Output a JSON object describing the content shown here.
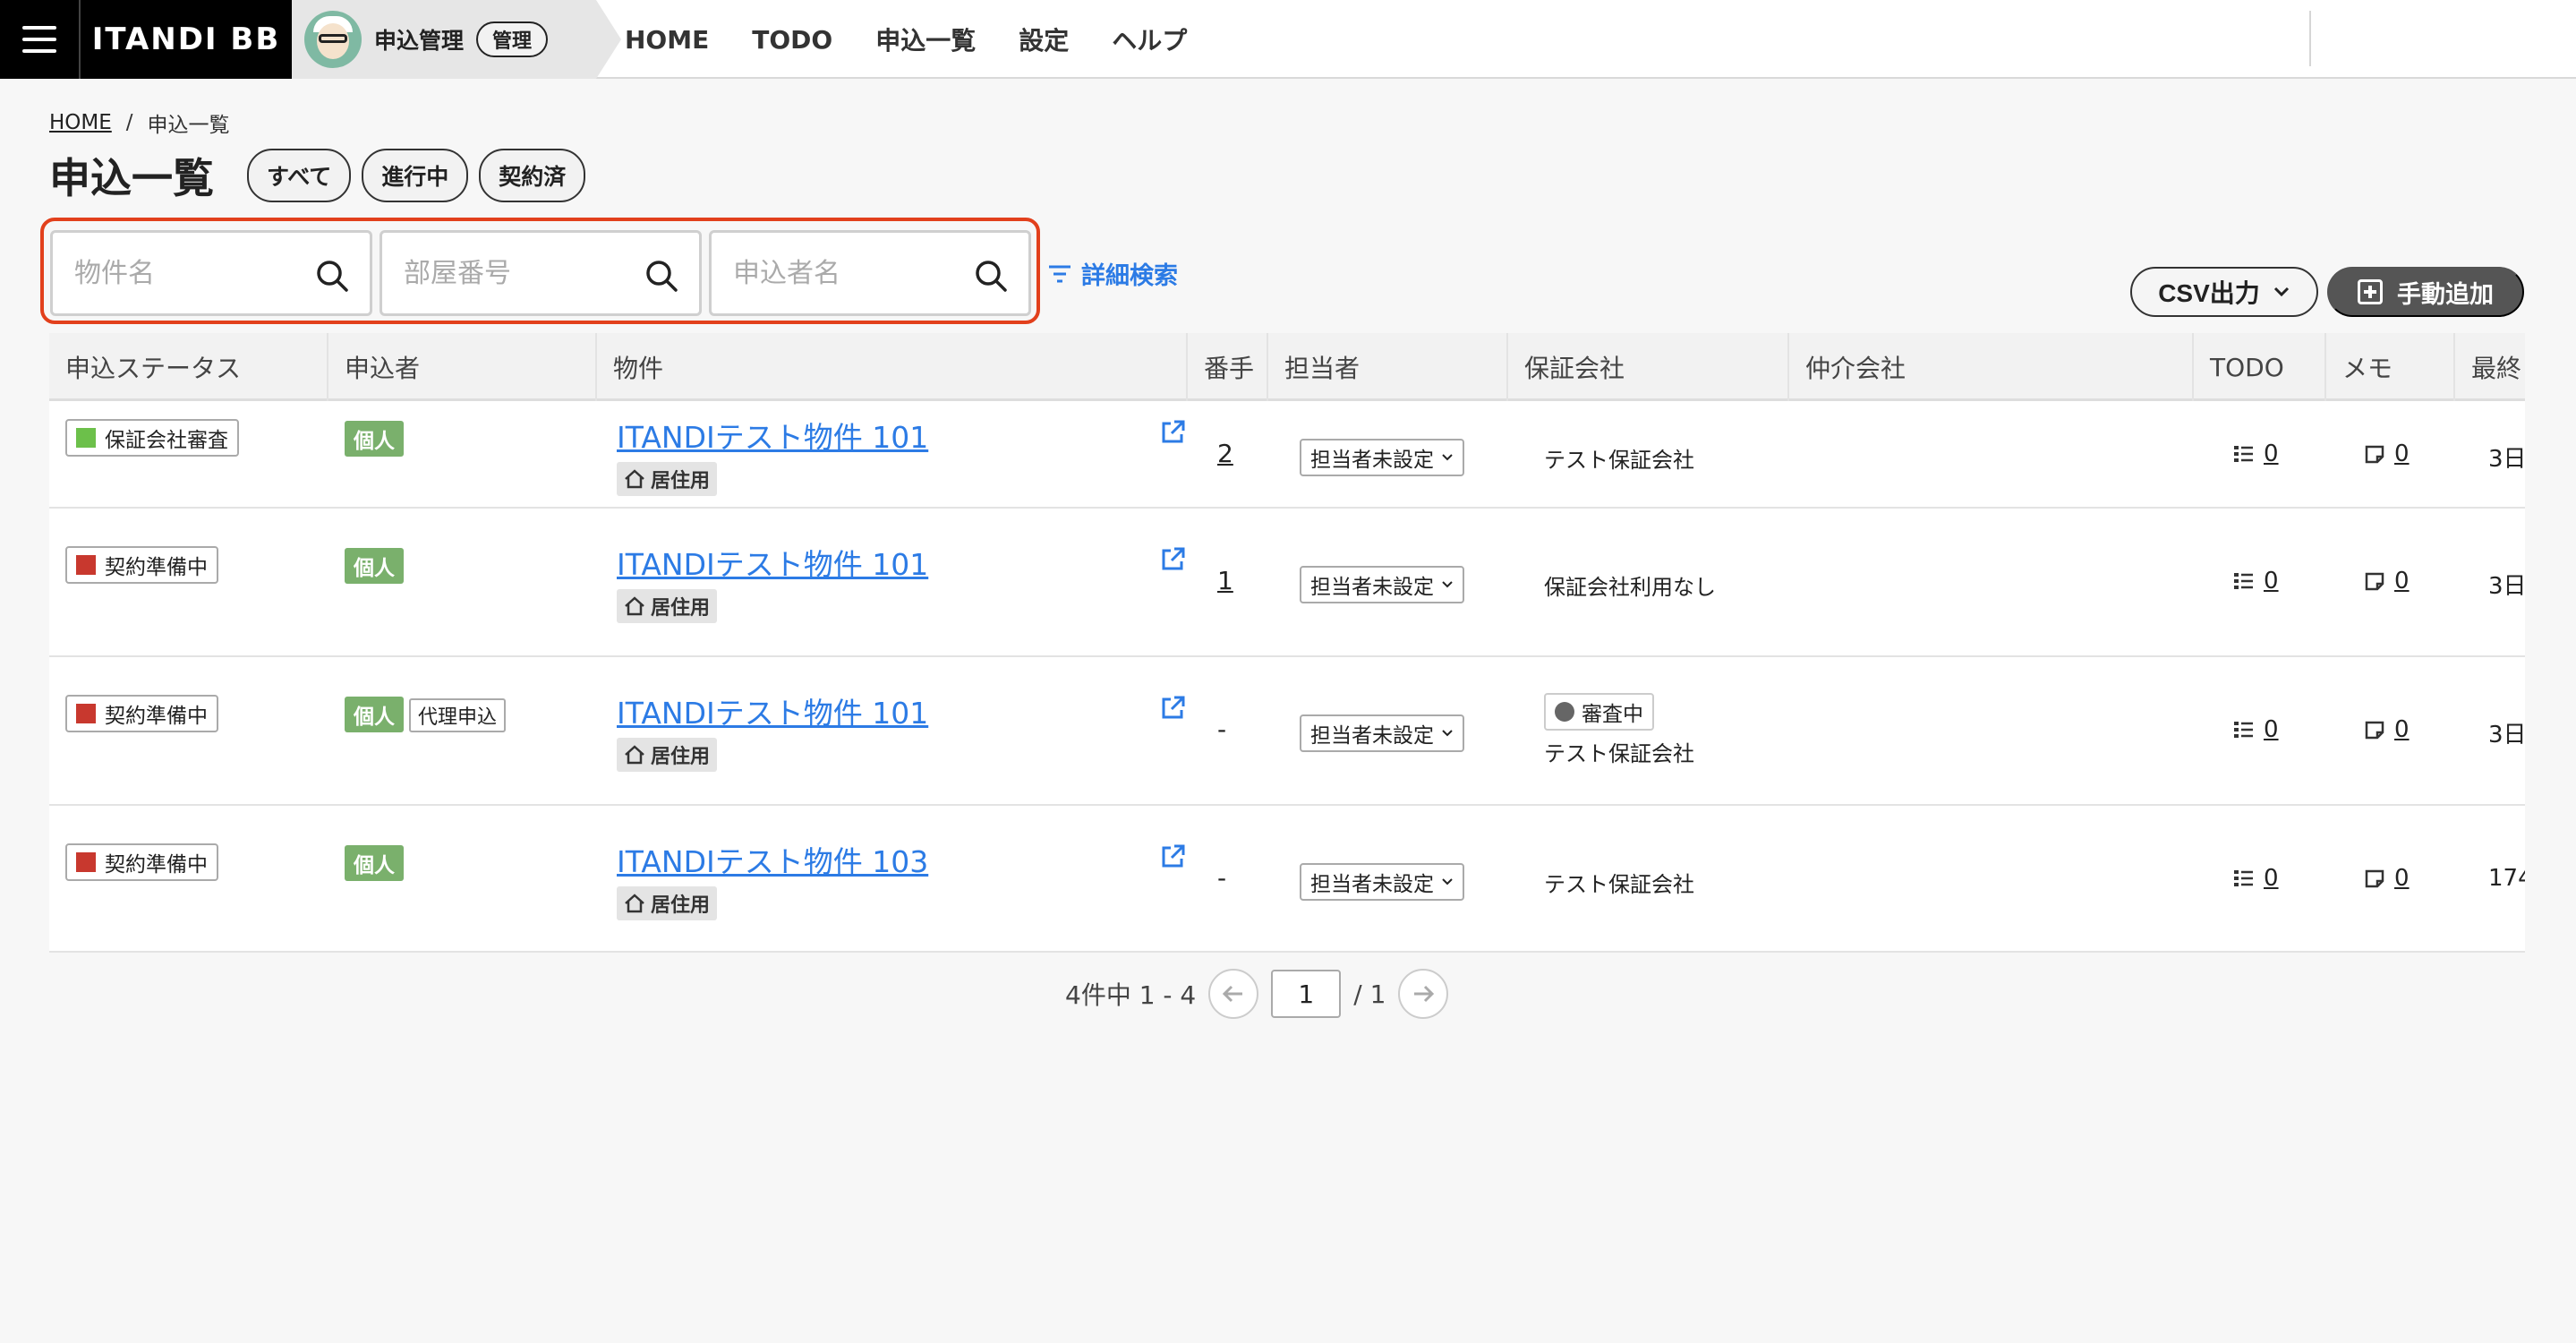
{
  "header": {
    "brand": "ITANDI BB",
    "app_title": "申込管理",
    "admin_badge": "管理",
    "nav": [
      "HOME",
      "TODO",
      "申込一覧",
      "設定",
      "ヘルプ"
    ]
  },
  "breadcrumb": {
    "home": "HOME",
    "separator": "/",
    "current": "申込一覧"
  },
  "page": {
    "title": "申込一覧",
    "filter_tabs": [
      "すべて",
      "進行中",
      "契約済"
    ]
  },
  "search": {
    "property_placeholder": "物件名",
    "room_placeholder": "部屋番号",
    "applicant_placeholder": "申込者名",
    "advanced_label": "詳細検索",
    "highlight_color": "#e2401c"
  },
  "actions": {
    "csv_label": "CSV出力",
    "add_label": "手動追加"
  },
  "table": {
    "columns": [
      "申込ステータス",
      "申込者",
      "物件",
      "番手",
      "担当者",
      "保証会社",
      "仲介会社",
      "TODO",
      "メモ",
      "最終"
    ],
    "rows": [
      {
        "status": "保証会社審査",
        "status_color": "#6cc04a",
        "applicant": "個人",
        "proxy": "",
        "property": "ITANDIテスト物件 101",
        "usage": "居住用",
        "number": "2",
        "assignee": "担当者未設定",
        "guarantor_badge": "",
        "guarantor": "テスト保証会社",
        "todo": "0",
        "memo": "0",
        "date": "3日"
      },
      {
        "status": "契約準備中",
        "status_color": "#c8382e",
        "applicant": "個人",
        "proxy": "",
        "property": "ITANDIテスト物件 101",
        "usage": "居住用",
        "number": "1",
        "assignee": "担当者未設定",
        "guarantor_badge": "",
        "guarantor": "保証会社利用なし",
        "todo": "0",
        "memo": "0",
        "date": "3日"
      },
      {
        "status": "契約準備中",
        "status_color": "#c8382e",
        "applicant": "個人",
        "proxy": "代理申込",
        "property": "ITANDIテスト物件 101",
        "usage": "居住用",
        "number": "-",
        "assignee": "担当者未設定",
        "guarantor_badge": "審査中",
        "guarantor": "テスト保証会社",
        "todo": "0",
        "memo": "0",
        "date": "3日"
      },
      {
        "status": "契約準備中",
        "status_color": "#c8382e",
        "applicant": "個人",
        "proxy": "",
        "property": "ITANDIテスト物件 103",
        "usage": "居住用",
        "number": "-",
        "assignee": "担当者未設定",
        "guarantor_badge": "",
        "guarantor": "テスト保証会社",
        "todo": "0",
        "memo": "0",
        "date": "174"
      }
    ]
  },
  "pagination": {
    "summary": "4件中 1 - 4",
    "current_page": "1",
    "total": "/ 1"
  },
  "icons": {
    "search": "search-icon",
    "filter": "filter-icon",
    "external": "external-link-icon",
    "home": "home-icon",
    "todo": "checklist-icon",
    "memo": "memo-icon",
    "prev": "arrow-left-icon",
    "next": "arrow-right-icon"
  }
}
